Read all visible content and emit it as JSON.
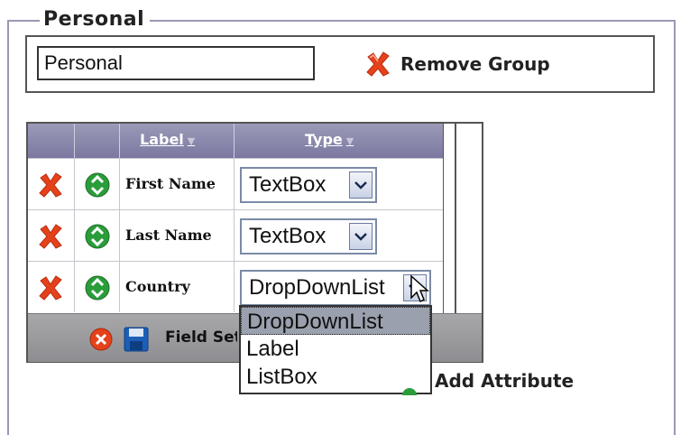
{
  "fieldset": {
    "legend": "Personal"
  },
  "group": {
    "name_value": "Personal",
    "remove_label": "Remove Group"
  },
  "grid": {
    "headers": [
      {
        "label": "Label",
        "sort_icon": "sort-arrow-down"
      },
      {
        "label": "Type",
        "sort_icon": "sort-arrow-down"
      }
    ],
    "rows": [
      {
        "label": "First Name",
        "type": "TextBox"
      },
      {
        "label": "Last Name",
        "type": "TextBox"
      },
      {
        "label": "Country",
        "type": "DropDownList"
      }
    ],
    "row_icons": {
      "delete": "delete-x-icon",
      "move": "move-down-icon"
    },
    "footer": {
      "text": "Field Set",
      "icons": [
        "cancel-icon",
        "save-icon"
      ]
    }
  },
  "dropdown": {
    "options": [
      "DropDownList",
      "Label",
      "ListBox"
    ],
    "selected": "DropDownList"
  },
  "actions": {
    "add_attribute": "Add Attribute"
  },
  "colors": {
    "header_bg": "#8a88ac",
    "footer_bg": "#9c9c9e",
    "delete_red": "#e5421b",
    "move_green": "#2a9d3a",
    "save_blue": "#1b5fb6"
  }
}
